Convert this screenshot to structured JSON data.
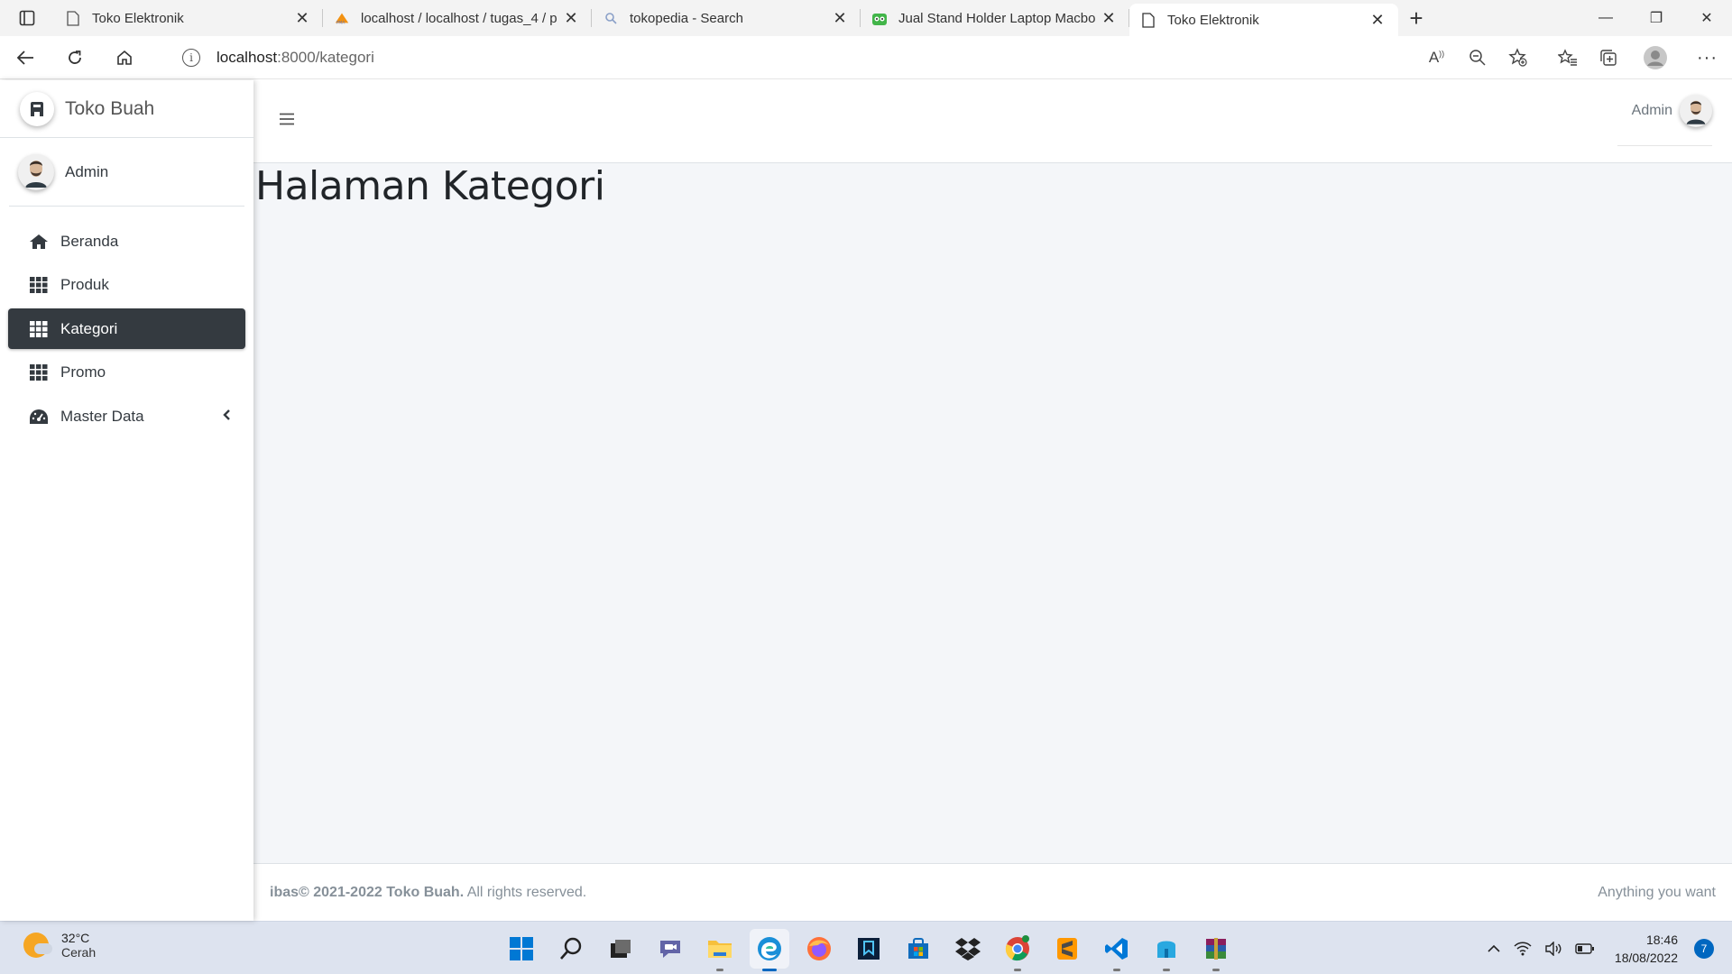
{
  "browser": {
    "tabs": [
      {
        "title": "Toko Elektronik",
        "icon": "page-icon",
        "active": false
      },
      {
        "title": "localhost / localhost / tugas_4 / p",
        "icon": "phpmyadmin-icon",
        "active": false
      },
      {
        "title": "tokopedia - Search",
        "icon": "search-icon",
        "active": false
      },
      {
        "title": "Jual Stand Holder Laptop Macbo",
        "icon": "tokopedia-icon",
        "active": false
      },
      {
        "title": "Toko Elektronik",
        "icon": "page-icon",
        "active": true
      }
    ],
    "url_host": "localhost",
    "url_path": ":8000/kategori"
  },
  "sidebar": {
    "brand": "Toko Buah",
    "user": "Admin",
    "items": [
      {
        "label": "Beranda",
        "icon": "home-icon",
        "active": false
      },
      {
        "label": "Produk",
        "icon": "grid-icon",
        "active": false
      },
      {
        "label": "Kategori",
        "icon": "grid-icon",
        "active": true
      },
      {
        "label": "Promo",
        "icon": "grid-icon",
        "active": false
      },
      {
        "label": "Master Data",
        "icon": "dashboard-icon",
        "active": false,
        "expandable": true
      }
    ]
  },
  "topnav": {
    "user": "Admin"
  },
  "main": {
    "title": "Halaman Kategori"
  },
  "footer": {
    "prefix": "ibas© 2021-2022 Toko Buah.",
    "suffix": " All rights reserved.",
    "right": "Anything you want"
  },
  "taskbar": {
    "temperature": "32°C",
    "weather": "Cerah",
    "time": "18:46",
    "date": "18/08/2022",
    "notifications": "7"
  },
  "colors": {
    "sidebar_active": "#343a40",
    "content_bg": "#f4f6f9"
  }
}
